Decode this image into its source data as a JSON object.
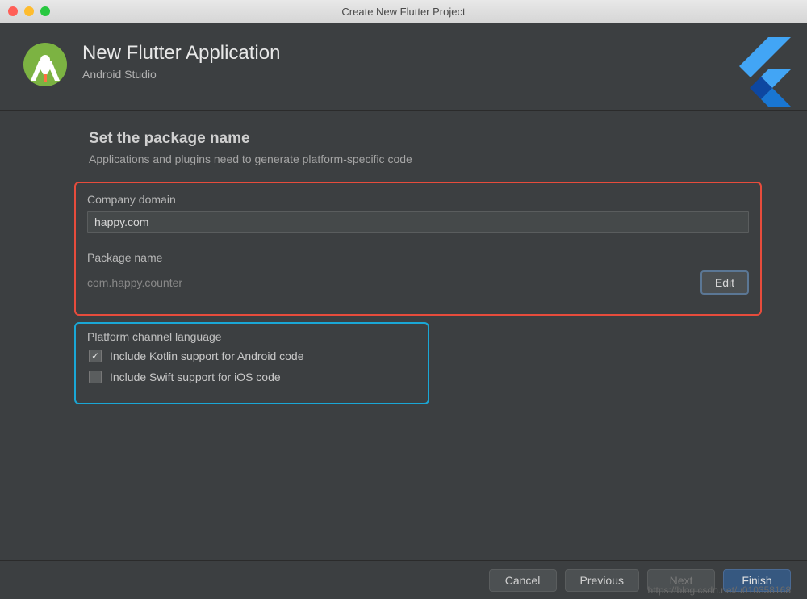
{
  "titlebar": {
    "title": "Create New Flutter Project"
  },
  "header": {
    "title": "New Flutter Application",
    "subtitle": "Android Studio"
  },
  "section": {
    "title": "Set the package name",
    "description": "Applications and plugins need to generate platform-specific code"
  },
  "form": {
    "company_domain_label": "Company domain",
    "company_domain_value": "happy.com",
    "package_name_label": "Package name",
    "package_name_value": "com.happy.counter",
    "edit_label": "Edit"
  },
  "platform": {
    "legend": "Platform channel language",
    "kotlin_label": "Include Kotlin support for Android code",
    "kotlin_checked": true,
    "swift_label": "Include Swift support for iOS code",
    "swift_checked": false
  },
  "footer": {
    "cancel": "Cancel",
    "previous": "Previous",
    "next": "Next",
    "finish": "Finish"
  },
  "watermark": "https://blog.csdn.net/u010358168"
}
